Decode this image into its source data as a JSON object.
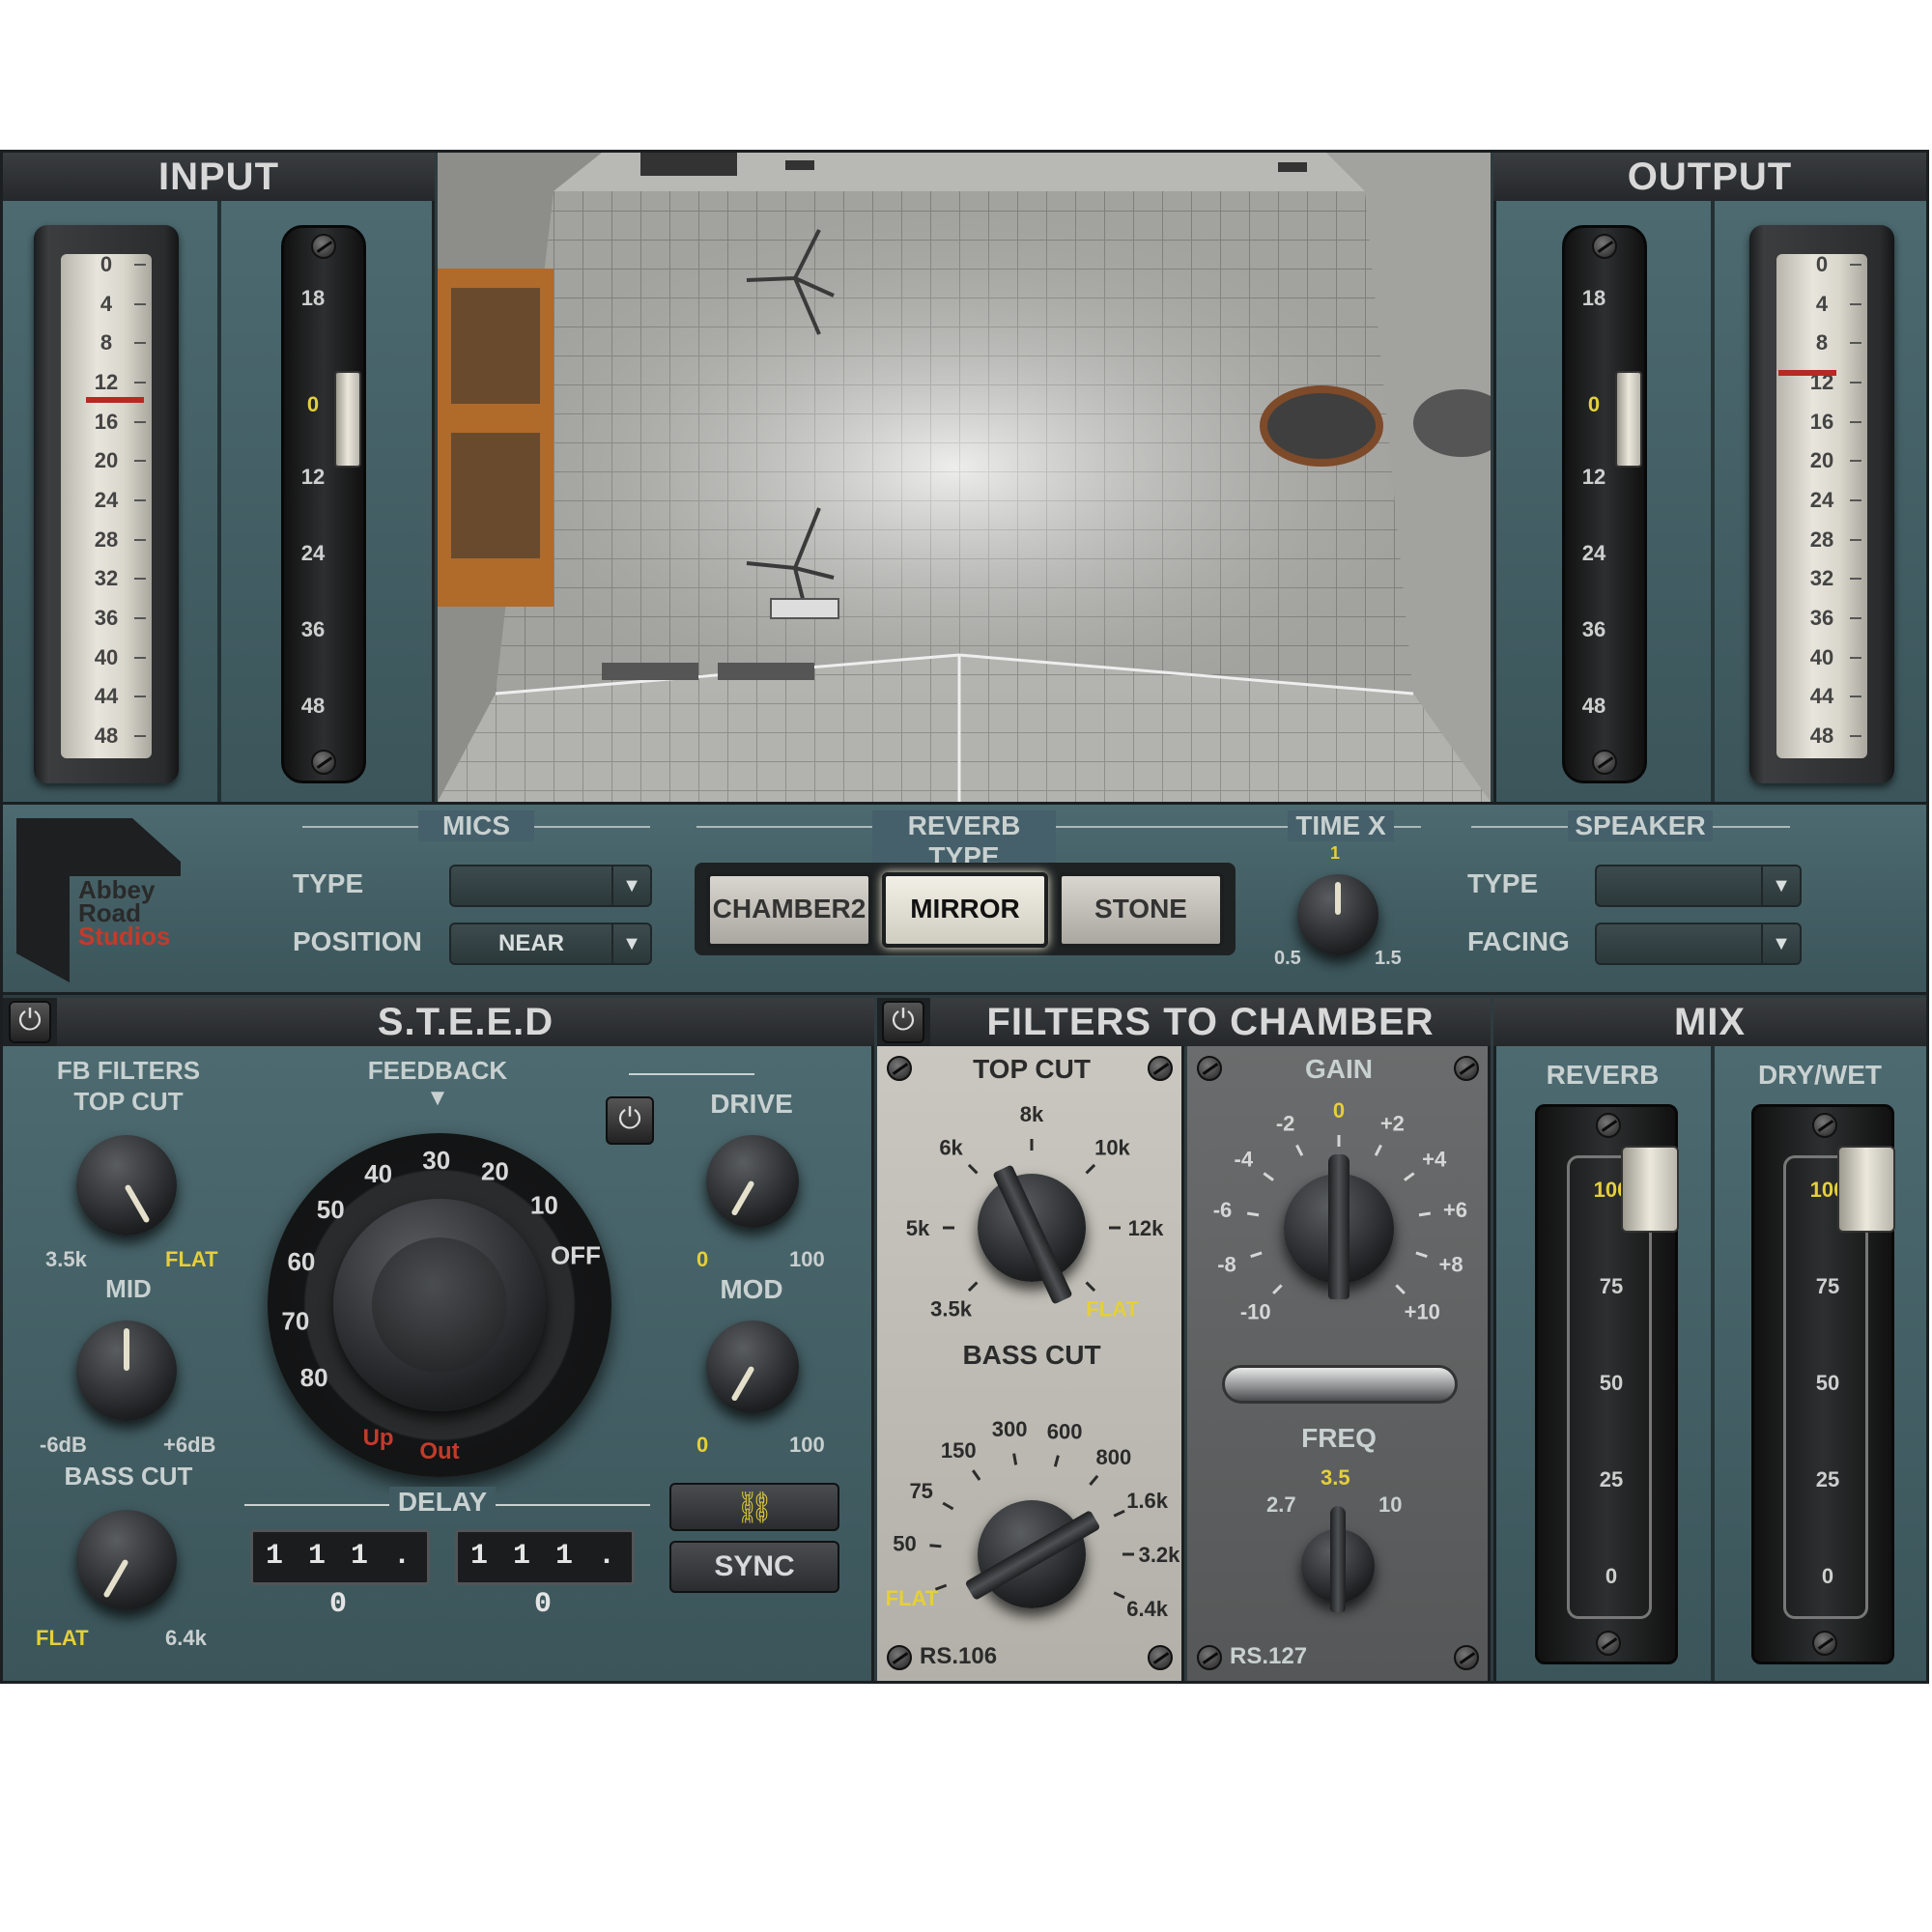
{
  "input": {
    "title": "INPUT",
    "vu_scale": [
      "0",
      "4",
      "8",
      "12",
      "16",
      "20",
      "24",
      "28",
      "32",
      "36",
      "40",
      "44",
      "48"
    ],
    "fader_scale": [
      "18",
      "0",
      "12",
      "24",
      "36",
      "48"
    ],
    "fader_level_db": 0
  },
  "output": {
    "title": "OUTPUT",
    "vu_scale": [
      "0",
      "4",
      "8",
      "12",
      "16",
      "20",
      "24",
      "28",
      "32",
      "36",
      "40",
      "44",
      "48"
    ],
    "fader_scale": [
      "18",
      "0",
      "12",
      "24",
      "36",
      "48"
    ],
    "fader_level_db": 0
  },
  "logo": {
    "line1": "Abbey",
    "line2": "Road",
    "line3": "Studios"
  },
  "mics": {
    "section_label": "MICS",
    "type_label": "TYPE",
    "type_value": "",
    "position_label": "POSITION",
    "position_value": "NEAR"
  },
  "reverb_type": {
    "section_label": "REVERB TYPE",
    "options": [
      "CHAMBER2",
      "MIRROR",
      "STONE"
    ],
    "selected": "MIRROR"
  },
  "time_x": {
    "label": "TIME X",
    "top": "1",
    "min": "0.5",
    "max": "1.5"
  },
  "speaker": {
    "section_label": "SPEAKER",
    "type_label": "TYPE",
    "type_value": "",
    "facing_label": "FACING",
    "facing_value": ""
  },
  "steed": {
    "title": "S.T.E.E.D",
    "fb_filters": "FB FILTERS",
    "top_cut": {
      "label": "TOP CUT",
      "min": "3.5k",
      "max": "FLAT"
    },
    "mid": {
      "label": "MID",
      "min": "-6dB",
      "max": "+6dB"
    },
    "bass_cut": {
      "label": "BASS CUT",
      "min": "FLAT",
      "max": "6.4k"
    },
    "feedback": {
      "label": "FEEDBACK",
      "marker": "▼",
      "scale": [
        "80",
        "70",
        "60",
        "50",
        "40",
        "30",
        "20",
        "10",
        "OFF"
      ],
      "red_marks": [
        "Up",
        "Out"
      ]
    },
    "drive": {
      "label": "DRIVE",
      "min": "0",
      "max": "100"
    },
    "mod": {
      "label": "MOD",
      "min": "0",
      "max": "100"
    },
    "delay": {
      "label": "DELAY",
      "left": "1 1 1 . 0",
      "right": "1 1 1 . 0"
    },
    "link_icon": "⛓",
    "sync_label": "SYNC"
  },
  "filters": {
    "title": "FILTERS TO CHAMBER",
    "rs106": {
      "top_cut_label": "TOP CUT",
      "top_cut_scale": [
        "3.5k",
        "5k",
        "6k",
        "8k",
        "10k",
        "12k",
        "FLAT"
      ],
      "bass_cut_label": "BASS CUT",
      "bass_cut_scale": [
        "FLAT",
        "50",
        "75",
        "150",
        "300",
        "600",
        "800",
        "1.6k",
        "3.2k",
        "6.4k"
      ],
      "model": "RS.106"
    },
    "rs127": {
      "gain_label": "GAIN",
      "gain_scale": [
        "-10",
        "-8",
        "-6",
        "-4",
        "-2",
        "0",
        "+2",
        "+4",
        "+6",
        "+8",
        "+10"
      ],
      "freq_label": "FREQ",
      "freq_scale": [
        "2.7",
        "3.5",
        "10"
      ],
      "model": "RS.127"
    }
  },
  "mix": {
    "title": "MIX",
    "reverb": {
      "label": "REVERB",
      "scale": [
        "100",
        "75",
        "50",
        "25",
        "0"
      ],
      "level": 100
    },
    "drywet": {
      "label": "DRY/WET",
      "scale": [
        "100",
        "75",
        "50",
        "25",
        "0"
      ],
      "level": 100
    }
  },
  "colors": {
    "panel": "#3b555a",
    "header": "#2a2c2e",
    "accent_yellow": "#e5cf3a",
    "accent_red": "#c23b2c"
  }
}
